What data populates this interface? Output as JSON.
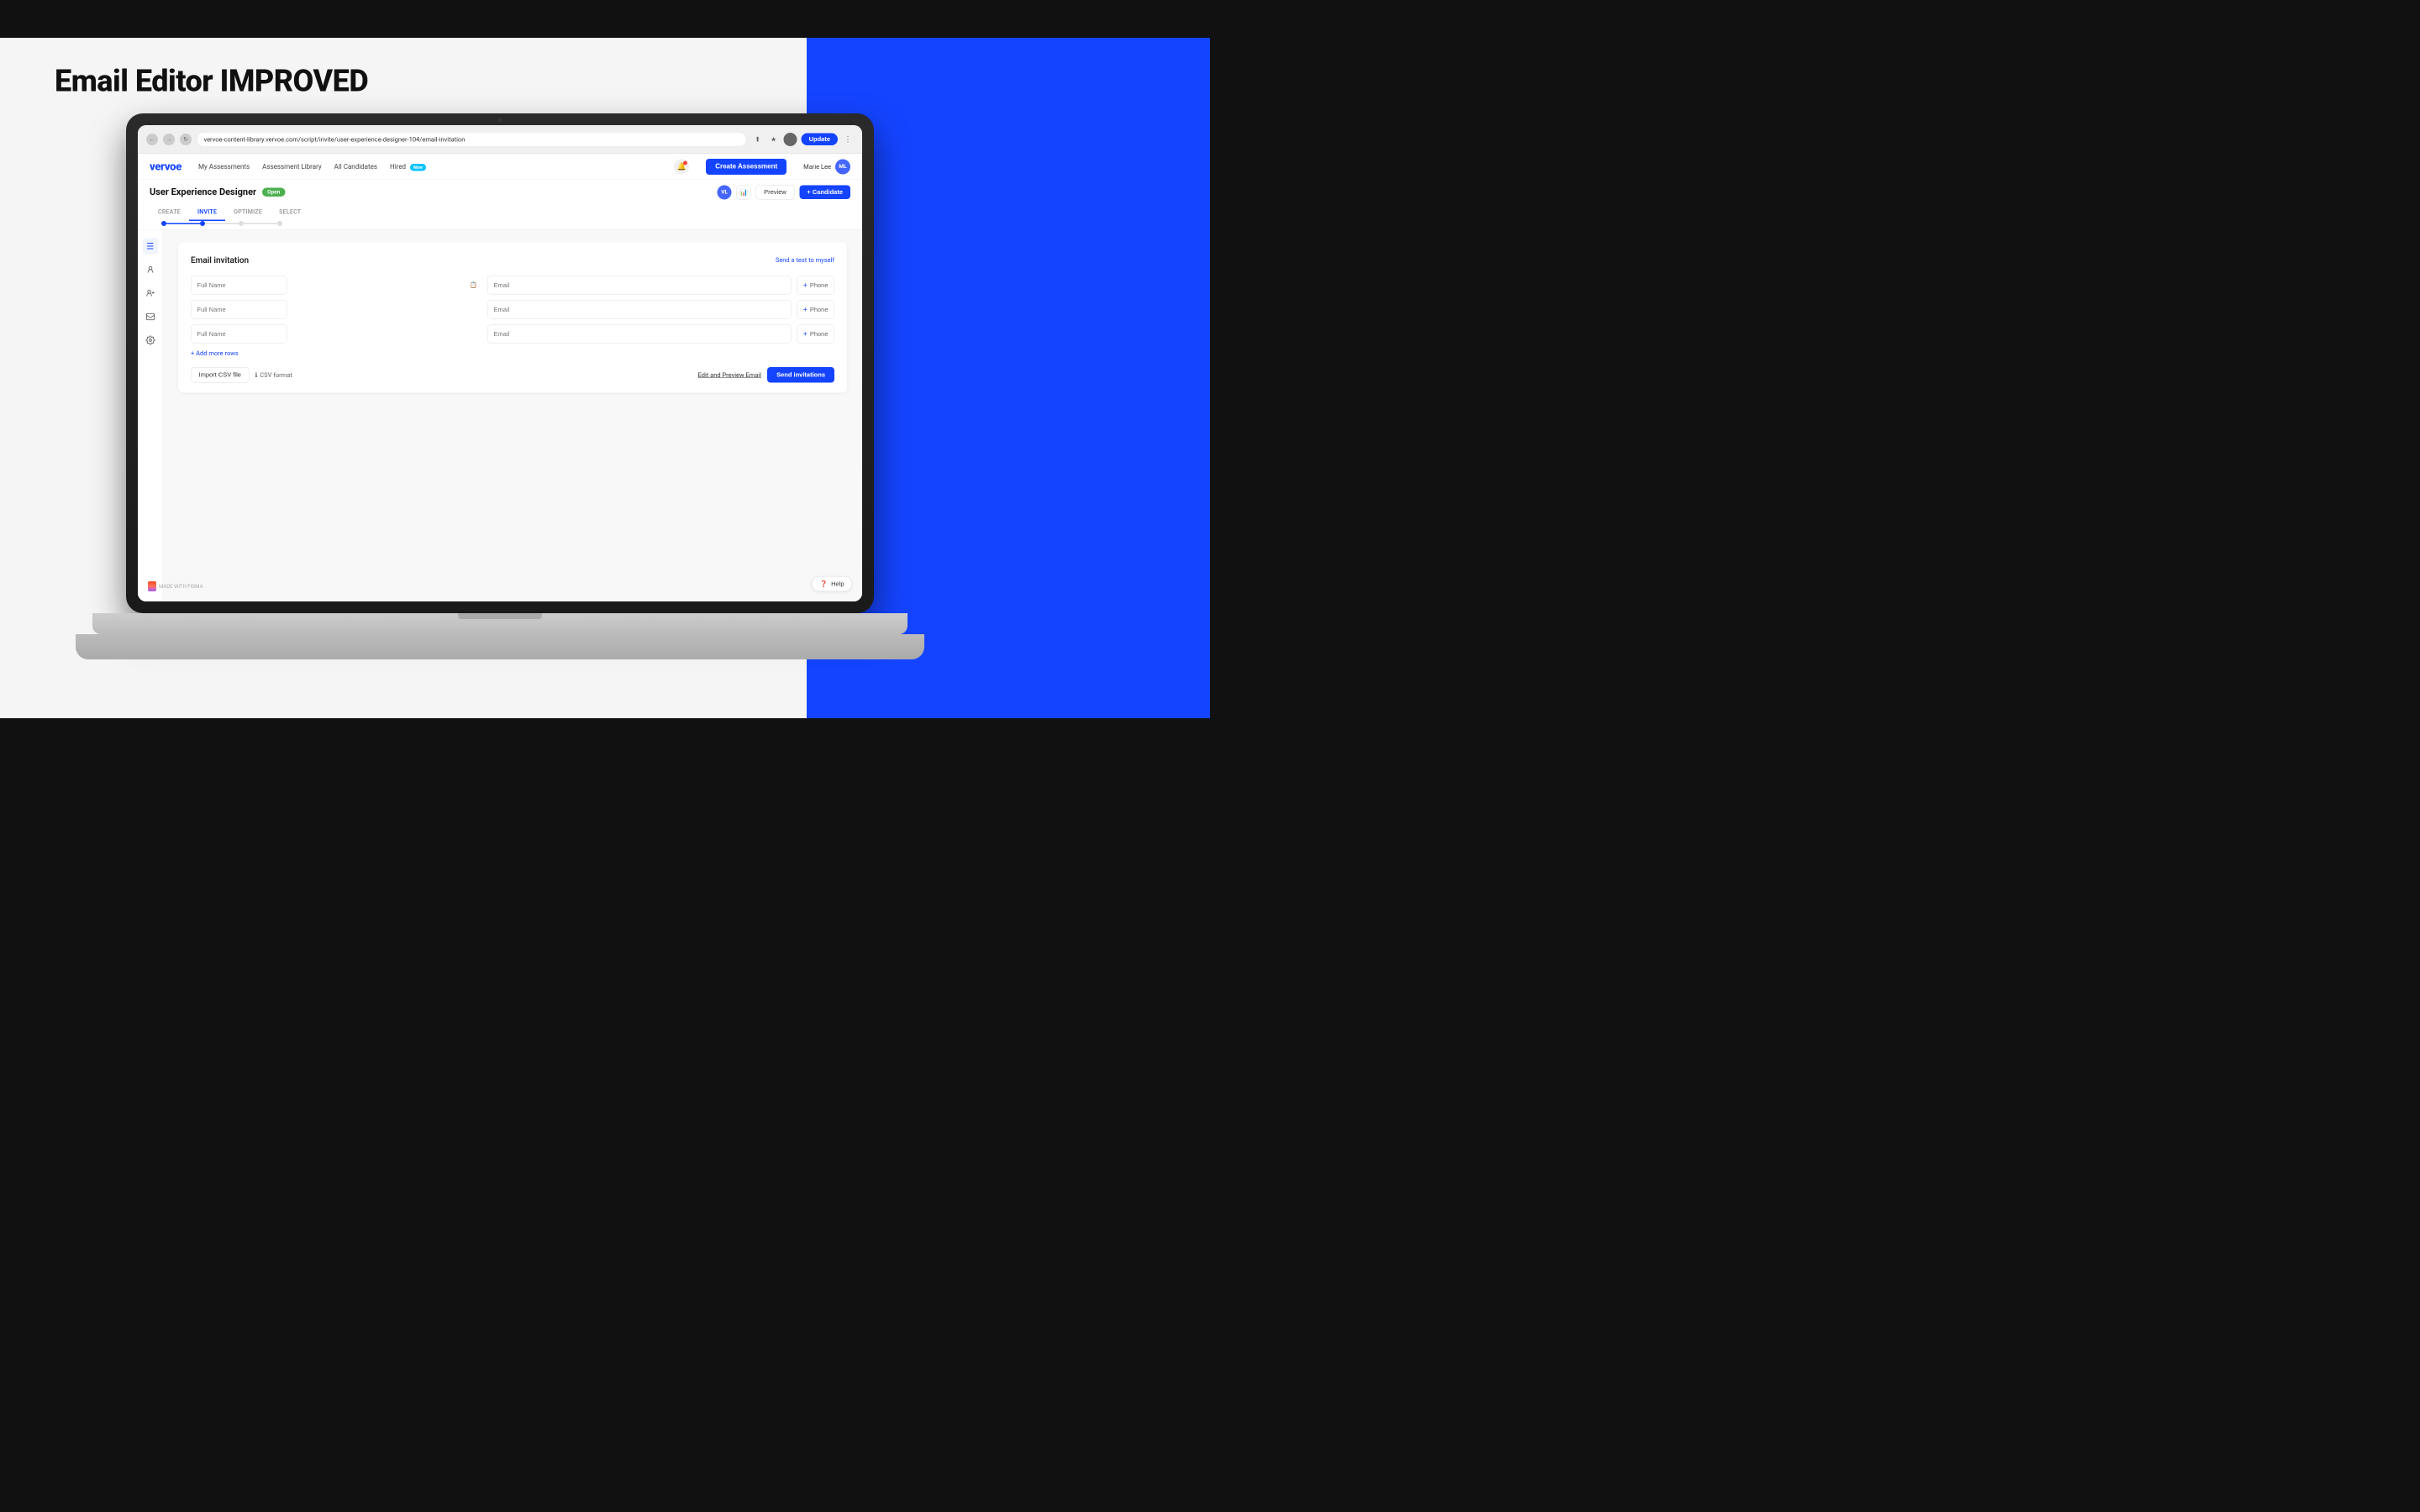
{
  "page": {
    "title": "Email Editor IMPROVED",
    "background_left": "#f5f5f5",
    "background_right": "#1444ff"
  },
  "browser": {
    "url": "vervoe-content-library.vervoe.com/script/invite/user-experience-designer-104/email-invitation",
    "update_btn": "Update"
  },
  "nav": {
    "brand": "vervoe",
    "links": [
      {
        "label": "My Assessments"
      },
      {
        "label": "Assessment Library"
      },
      {
        "label": "All Candidates"
      },
      {
        "label": "Hired",
        "badge": "New"
      }
    ],
    "create_btn": "Create Assessment",
    "user_name": "Marie Lee",
    "user_initials": "ML"
  },
  "sub_header": {
    "assessment_title": "User Experience Designer",
    "status_badge": "Open",
    "vl_initials": "VL",
    "preview_btn": "Preview",
    "add_candidate_btn": "+ Candidate"
  },
  "tabs": [
    {
      "label": "CREATE",
      "active": false
    },
    {
      "label": "INVITE",
      "active": true
    },
    {
      "label": "OPTIMIZE",
      "active": false
    },
    {
      "label": "SELECT",
      "active": false
    }
  ],
  "email_card": {
    "title": "Email invitation",
    "send_test_link": "Send a test to myself",
    "rows": [
      {
        "full_name_placeholder": "Full Name",
        "email_placeholder": "Email",
        "phone_label": "Phone",
        "has_csv_icon": true
      },
      {
        "full_name_placeholder": "Full Name",
        "email_placeholder": "Email",
        "phone_label": "Phone",
        "has_csv_icon": false
      },
      {
        "full_name_placeholder": "Full Name",
        "email_placeholder": "Email",
        "phone_label": "Phone",
        "has_csv_icon": false
      }
    ],
    "add_rows_label": "+ Add more rows",
    "import_csv_btn": "Import CSV file",
    "csv_format_label": "CSV format",
    "edit_preview_label": "Edit and Preview Email",
    "send_invitations_btn": "Send invitations"
  },
  "help_btn": "Help",
  "figma_badge": "MADE WITH FIGMA",
  "sidebar_icons": [
    {
      "name": "menu-icon",
      "symbol": "☰",
      "active": true
    },
    {
      "name": "users-icon",
      "symbol": "👤",
      "active": false
    },
    {
      "name": "user-add-icon",
      "symbol": "👥",
      "active": false
    },
    {
      "name": "email-icon",
      "symbol": "✉",
      "active": false
    },
    {
      "name": "settings-icon",
      "symbol": "⚙",
      "active": false
    }
  ]
}
